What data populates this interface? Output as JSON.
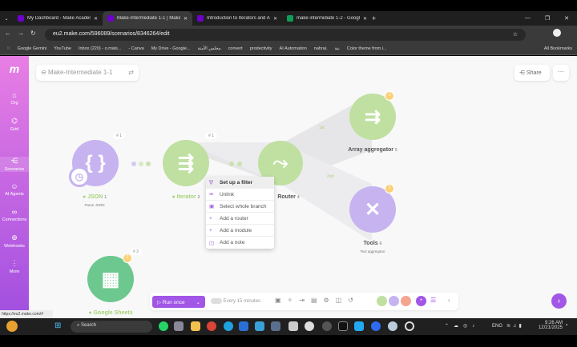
{
  "browser": {
    "tabs": [
      {
        "label": "My Dashboard - Make Academ",
        "icon": "make-icon"
      },
      {
        "label": "Make-Intermediate 1-1 | Make",
        "icon": "make-icon",
        "active": true
      },
      {
        "label": "Introduction to Iterators and A",
        "icon": "make-icon"
      },
      {
        "label": "make intermidiate 1-2 - Google",
        "icon": "sheets-icon"
      }
    ],
    "url": "eu2.make.com/596089/scenarios/8346264/edit",
    "bookmarks": [
      "Google Gemini",
      "YouTube",
      "Inbox (220) - o.mals...",
      "- Canva",
      "My Drive - Google...",
      "مجلس الأمنة",
      "convert",
      "prodectivity",
      "AI Automation",
      "nahrai.",
      "نية",
      "Color theme from i..."
    ],
    "all_bookmarks": "All Bookmarks",
    "status_url": "https://eu2.make.com/#"
  },
  "sidebar": {
    "items": [
      {
        "label": "Org",
        "icon": "home-icon"
      },
      {
        "label": "Grid",
        "icon": "grid-icon",
        "badge": "BETA"
      },
      {
        "label": "Scenarios",
        "icon": "share-icon",
        "active": true
      },
      {
        "label": "AI Agents",
        "icon": "ai-icon",
        "badge": "BETA"
      },
      {
        "label": "Connections",
        "icon": "link-icon"
      },
      {
        "label": "Webhooks",
        "icon": "globe-icon"
      },
      {
        "label": "More",
        "icon": "more-icon"
      }
    ]
  },
  "scenario": {
    "title": "Make-Intermediate 1-1",
    "share": "Share"
  },
  "modules": [
    {
      "name": "JSON",
      "sub": "Parse JSON",
      "id": "1",
      "tag": "# 1",
      "color": "#c6b3f0",
      "glyph": "{ }"
    },
    {
      "name": "Iterator",
      "id": "2",
      "tag": "# 1",
      "color": "#bfe0a0",
      "glyph": "⇶"
    },
    {
      "name": "Router",
      "id": "4",
      "color": "#bfe0a0",
      "glyph": "⤳"
    },
    {
      "name": "Array aggregator",
      "id": "5",
      "badge": "1",
      "color": "#bfe0a0",
      "glyph": "⇉"
    },
    {
      "name": "Tools",
      "sub": "Text aggregator",
      "id": "6",
      "badge": "1",
      "color": "#c6b3f0",
      "glyph": "✕"
    },
    {
      "name": "Google Sheets",
      "id": "3",
      "tag": "# 3",
      "badge": "2",
      "color": "#6cc88e",
      "glyph": "▦"
    }
  ],
  "routes": [
    "1st",
    "2nd"
  ],
  "context_menu": [
    {
      "label": "Set up a filter",
      "icon": "filter-icon"
    },
    {
      "label": "Unlink",
      "icon": "unlink-icon"
    },
    {
      "label": "Select whole branch",
      "icon": "branch-icon"
    },
    {
      "label": "Add a router",
      "icon": "plus-icon"
    },
    {
      "label": "Add a module",
      "icon": "plus-icon"
    },
    {
      "label": "Add a note",
      "icon": "note-icon"
    }
  ],
  "toolbar": {
    "run": "Run once",
    "schedule": "Every 15 minutes"
  },
  "taskbar": {
    "search": "Search",
    "lang": "ENG",
    "time": "9:26 AM",
    "date": "12/21/2025"
  }
}
